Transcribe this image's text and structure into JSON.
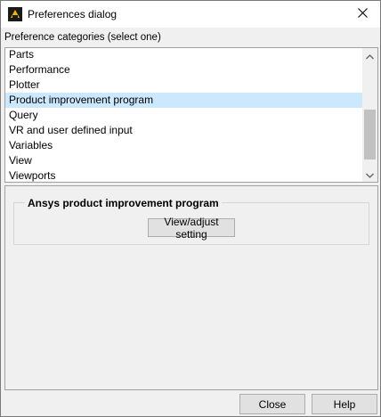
{
  "window": {
    "title": "Preferences dialog"
  },
  "categories": {
    "prompt": "Preference categories (select one)",
    "items": [
      {
        "label": "Parts"
      },
      {
        "label": "Performance"
      },
      {
        "label": "Plotter"
      },
      {
        "label": "Product improvement program"
      },
      {
        "label": "Query"
      },
      {
        "label": "VR and user defined input"
      },
      {
        "label": "Variables"
      },
      {
        "label": "View"
      },
      {
        "label": "Viewports"
      }
    ],
    "selected_label": "Product improvement program"
  },
  "detail": {
    "group_title": "Ansys product improvement program",
    "view_button_label": "View/adjust setting"
  },
  "footer": {
    "close_label": "Close",
    "help_label": "Help"
  },
  "colors": {
    "selection": "#cce8ff"
  },
  "icons": {
    "app": "app-logo-icon",
    "close": "close-icon",
    "scroll_up": "chevron-up-icon",
    "scroll_down": "chevron-down-icon"
  }
}
